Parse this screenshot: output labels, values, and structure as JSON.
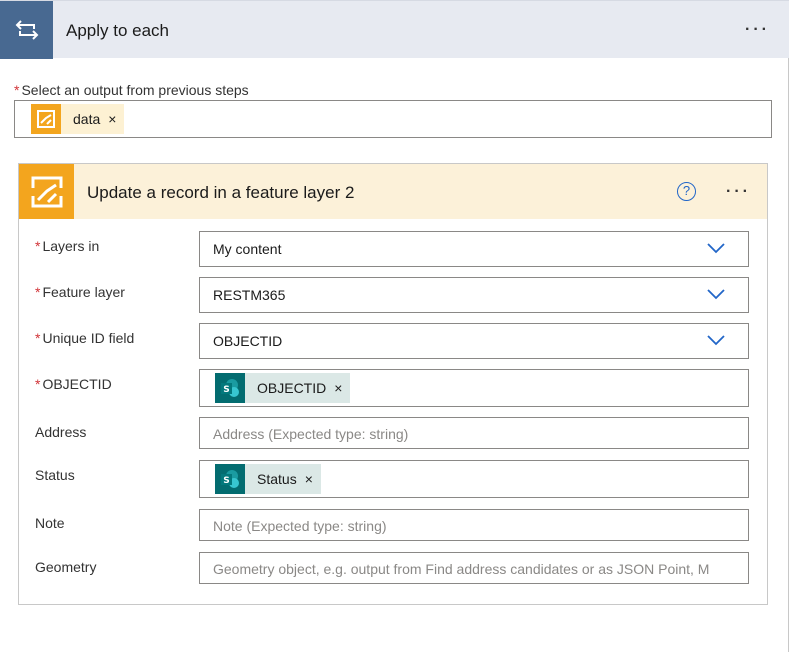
{
  "outer": {
    "title": "Apply to each",
    "menu": "···",
    "select_label": "Select an output from previous steps",
    "required_mark": "*",
    "token": {
      "label": "data",
      "remove": "×"
    }
  },
  "card": {
    "title": "Update a record in a feature layer 2",
    "help": "?",
    "menu": "···",
    "fields": {
      "layers_in": {
        "label": "Layers in",
        "value": "My content"
      },
      "feature_layer": {
        "label": "Feature layer",
        "value": "RESTM365"
      },
      "unique_id": {
        "label": "Unique ID field",
        "value": "OBJECTID"
      },
      "objectid": {
        "label": "OBJECTID",
        "token": "OBJECTID",
        "remove": "×"
      },
      "address": {
        "label": "Address",
        "placeholder": "Address (Expected type: string)"
      },
      "status": {
        "label": "Status",
        "token": "Status",
        "remove": "×"
      },
      "note": {
        "label": "Note",
        "placeholder": "Note (Expected type: string)"
      },
      "geometry": {
        "label": "Geometry",
        "placeholder": "Geometry object, e.g. output from Find address candidates or as JSON Point, M"
      }
    }
  },
  "icons": {
    "loop": "loop-icon",
    "arcgis": "arcgis-connector-icon",
    "sharepoint": "sharepoint-icon",
    "chevron": "chevron-down-icon"
  },
  "colors": {
    "loop_tile": "#486991",
    "arcgis_tile": "#f3a51e",
    "sharepoint": "#036c70",
    "required": "#d13438",
    "chevron": "#2266c8"
  }
}
